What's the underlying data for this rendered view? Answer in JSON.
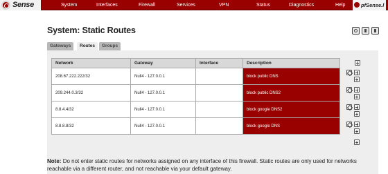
{
  "brand": {
    "logo_text": "Sense"
  },
  "menu": {
    "items": [
      "System",
      "Interfaces",
      "Firewall",
      "Services",
      "VPN",
      "Status",
      "Diagnostics",
      "Help"
    ],
    "hostname": "pfSense.l"
  },
  "page": {
    "title": "System: Static Routes"
  },
  "tabs": [
    {
      "label": "Gateways",
      "active": false
    },
    {
      "label": "Routes",
      "active": true
    },
    {
      "label": "Groups",
      "active": false
    }
  ],
  "table": {
    "headers": [
      "Network",
      "Gateway",
      "Interface",
      "Description"
    ],
    "rows": [
      {
        "network": "208.67.222.222/32",
        "gateway": "Null4 - 127.0.0.1",
        "interface": "",
        "description": "block public DNS"
      },
      {
        "network": "209.244.0.3/32",
        "gateway": "Null4 - 127.0.0.1",
        "interface": "",
        "description": "block public DNS2"
      },
      {
        "network": "8.8.4.4/32",
        "gateway": "Null4 - 127.0.0.1",
        "interface": "",
        "description": "block google DNS2"
      },
      {
        "network": "8.8.8.8/32",
        "gateway": "Null4 - 127.0.0.1",
        "interface": "",
        "description": "block google DNS"
      }
    ]
  },
  "note": {
    "label": "Note:",
    "text": "Do not enter static routes for networks assigned on any interface of this firewall. Static routes are only used for networks reachable via a different router, and not reachable via your default gateway."
  },
  "colors": {
    "brand": "#990000",
    "panel": "#eeeeee"
  }
}
